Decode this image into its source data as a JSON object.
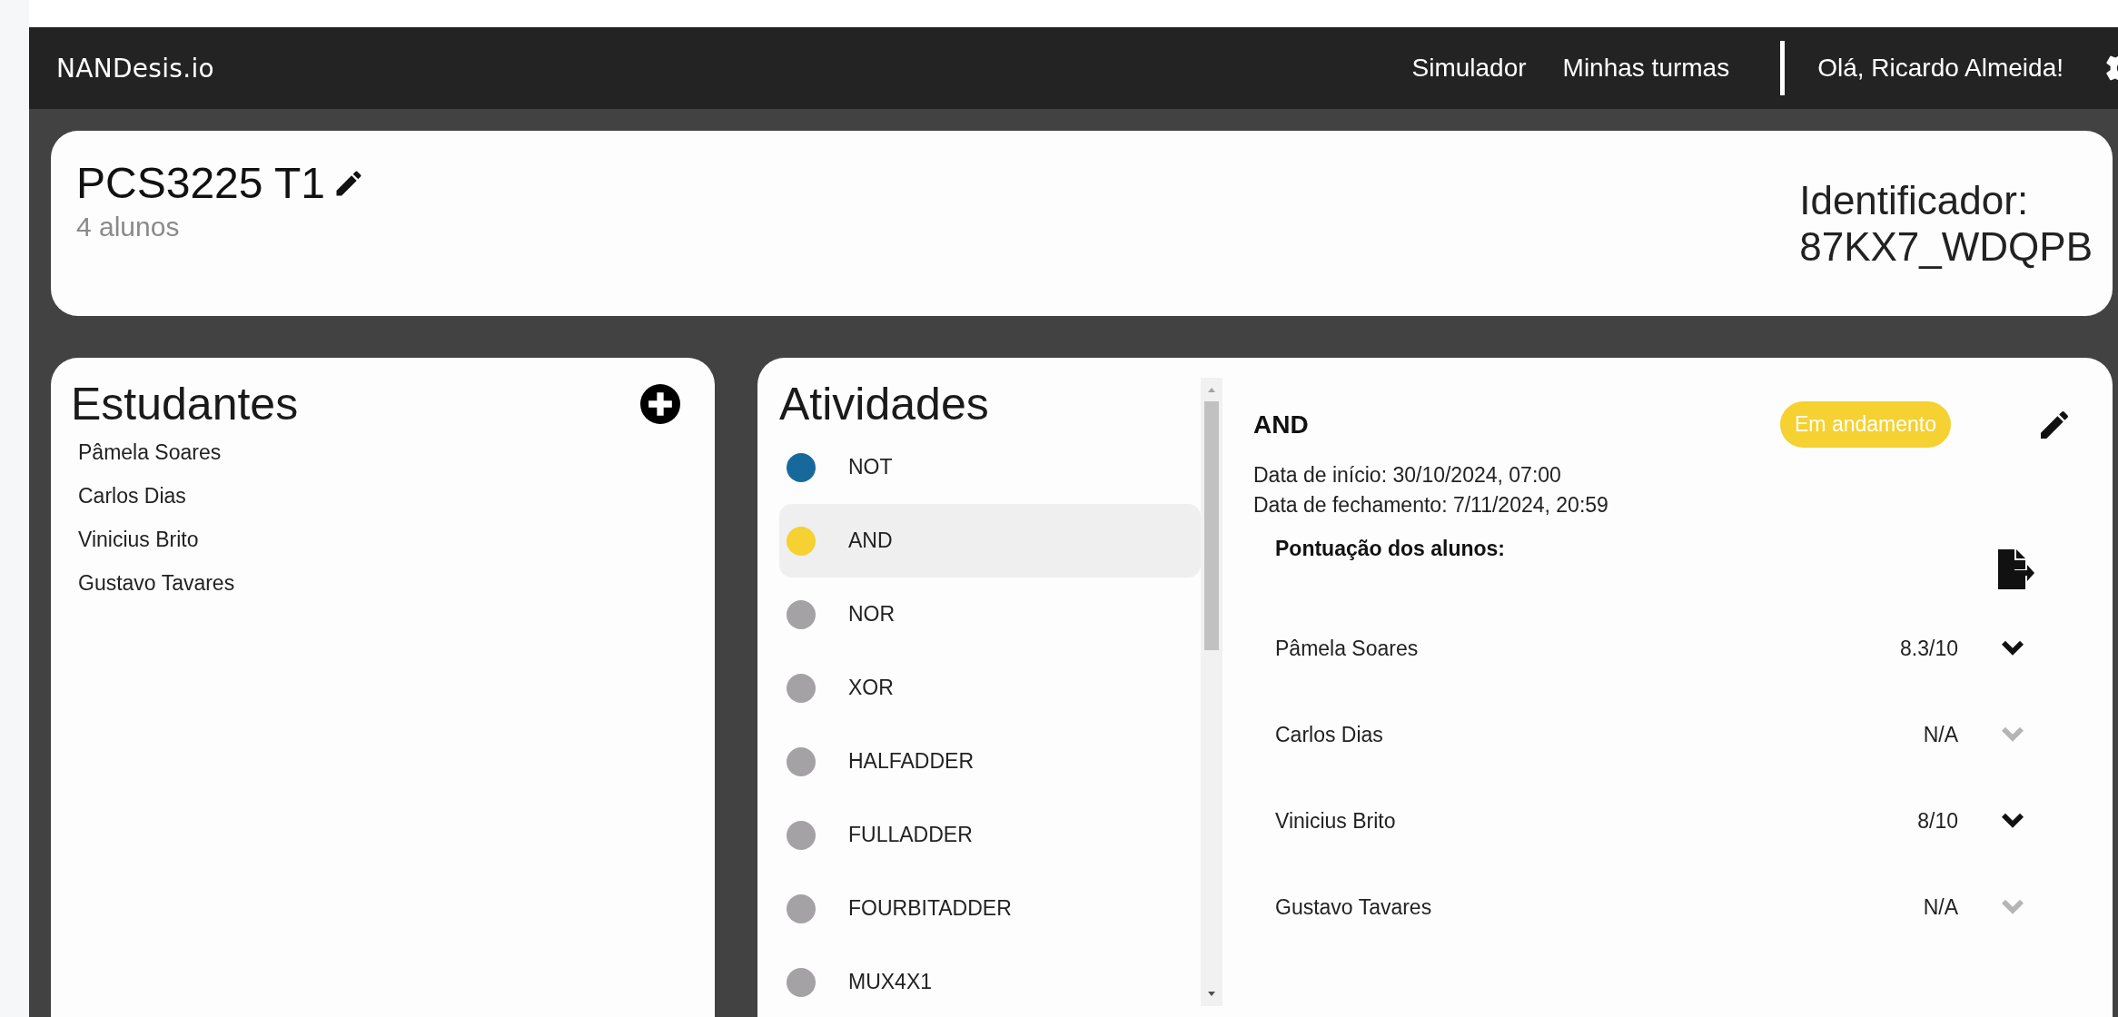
{
  "app_name": "NANDesis.io",
  "nav": [
    {
      "label": "Simulador"
    },
    {
      "label": "Minhas turmas"
    }
  ],
  "greeting": "Olá, Ricardo Almeida!",
  "class_header": {
    "title": "PCS3225 T1",
    "subtitle": "4 alunos",
    "identifier_label": "Identificador:",
    "identifier": "87KX7_WDQPB"
  },
  "students": {
    "title": "Estudantes",
    "items": [
      {
        "name": "Pâmela Soares"
      },
      {
        "name": "Carlos Dias"
      },
      {
        "name": "Vinicius Brito"
      },
      {
        "name": "Gustavo Tavares"
      }
    ]
  },
  "activities": {
    "title": "Atividades",
    "items": [
      {
        "name": "NOT",
        "color": "#17699c",
        "selected": false
      },
      {
        "name": "AND",
        "color": "#f5d131",
        "selected": true
      },
      {
        "name": "NOR",
        "color": "#a4a2a4",
        "selected": false
      },
      {
        "name": "XOR",
        "color": "#a4a2a4",
        "selected": false
      },
      {
        "name": "HALFADDER",
        "color": "#a4a2a4",
        "selected": false
      },
      {
        "name": "FULLADDER",
        "color": "#a4a2a4",
        "selected": false
      },
      {
        "name": "FOURBITADDER",
        "color": "#a4a2a4",
        "selected": false
      },
      {
        "name": "MUX4X1",
        "color": "#a4a2a4",
        "selected": false
      }
    ]
  },
  "detail": {
    "title": "AND",
    "status": "Em andamento",
    "start": "Data de início: 30/10/2024, 07:00",
    "end": "Data de fechamento: 7/11/2024, 20:59",
    "scores_title": "Pontuação dos alunos:",
    "scores": [
      {
        "name": "Pâmela Soares",
        "score": "8.3/10",
        "disabled": false
      },
      {
        "name": "Carlos Dias",
        "score": "N/A",
        "disabled": true
      },
      {
        "name": "Vinicius Brito",
        "score": "8/10",
        "disabled": false
      },
      {
        "name": "Gustavo Tavares",
        "score": "N/A",
        "disabled": true
      }
    ]
  }
}
